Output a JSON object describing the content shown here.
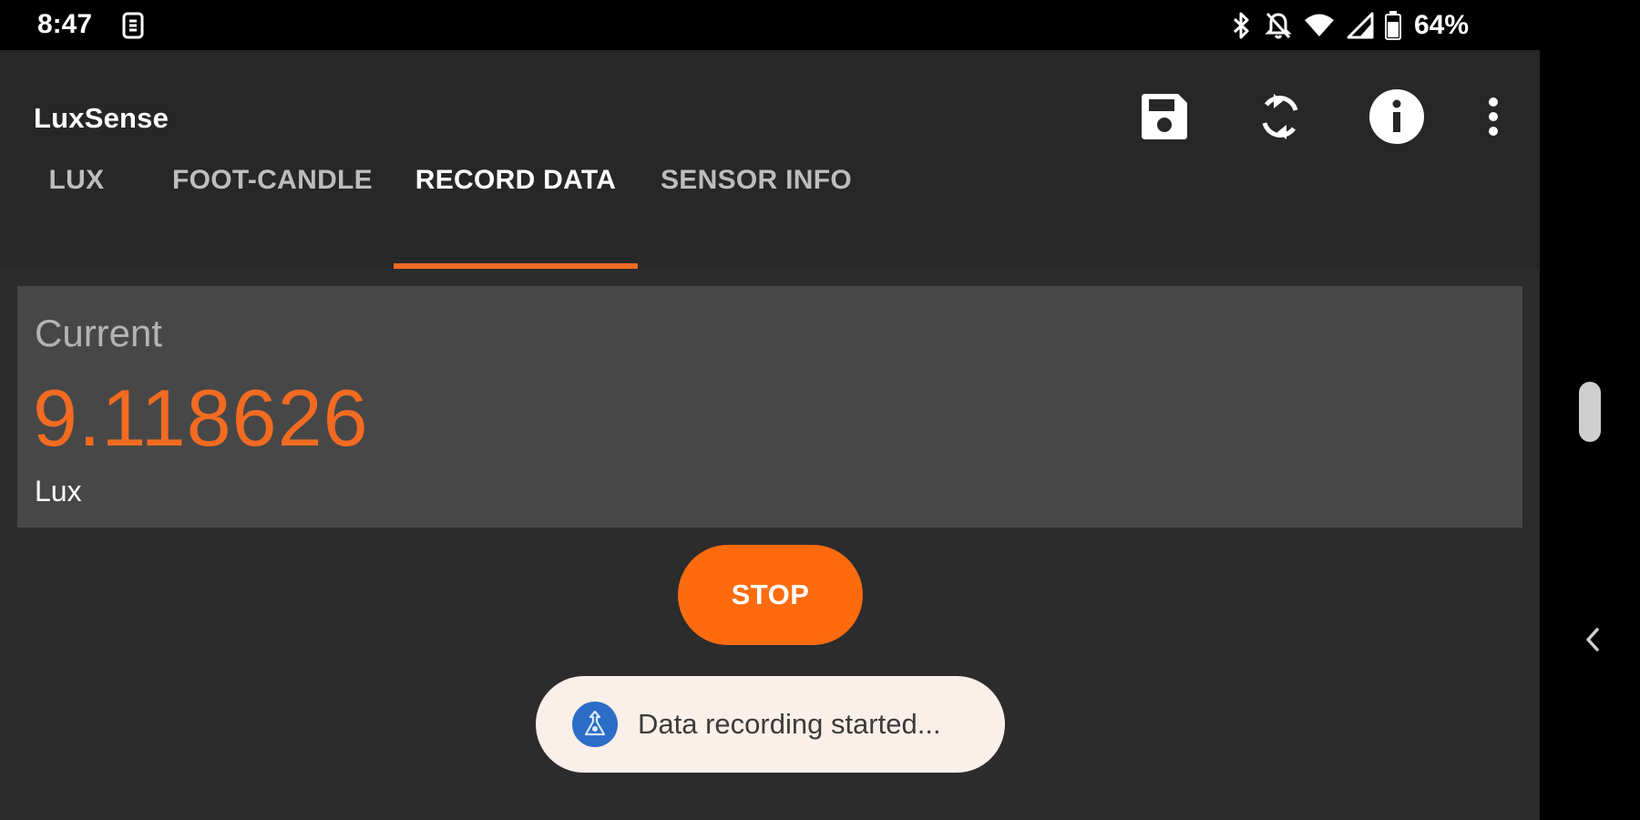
{
  "status_bar": {
    "time": "8:47",
    "left_icon": "device-info-icon",
    "right_icons": [
      "bluetooth-icon",
      "notifications-off-icon",
      "wifi-icon",
      "signal-icon",
      "battery-icon"
    ],
    "battery_percent": "64%"
  },
  "app": {
    "title": "LuxSense",
    "actions": [
      "save-icon",
      "refresh-icon",
      "info-icon",
      "more-vert-icon"
    ]
  },
  "tabs": {
    "items": [
      {
        "label": "LUX"
      },
      {
        "label": "FOOT-CANDLE"
      },
      {
        "label": "RECORD DATA"
      },
      {
        "label": "SENSOR INFO"
      }
    ],
    "active_index": 2
  },
  "reading": {
    "label": "Current",
    "value": "9.118626",
    "unit": "Lux"
  },
  "controls": {
    "stop_label": "STOP"
  },
  "toast": {
    "icon": "app-icon",
    "message": "Data recording started..."
  },
  "nav_rail": {
    "icons": [
      "scrollbar-handle",
      "chevron-left-icon"
    ]
  },
  "colors": {
    "accent": "#f26b21",
    "button": "#fe6b0f",
    "background": "#2c2c2c",
    "card": "#474747",
    "toast_bg": "#fbefe9"
  }
}
